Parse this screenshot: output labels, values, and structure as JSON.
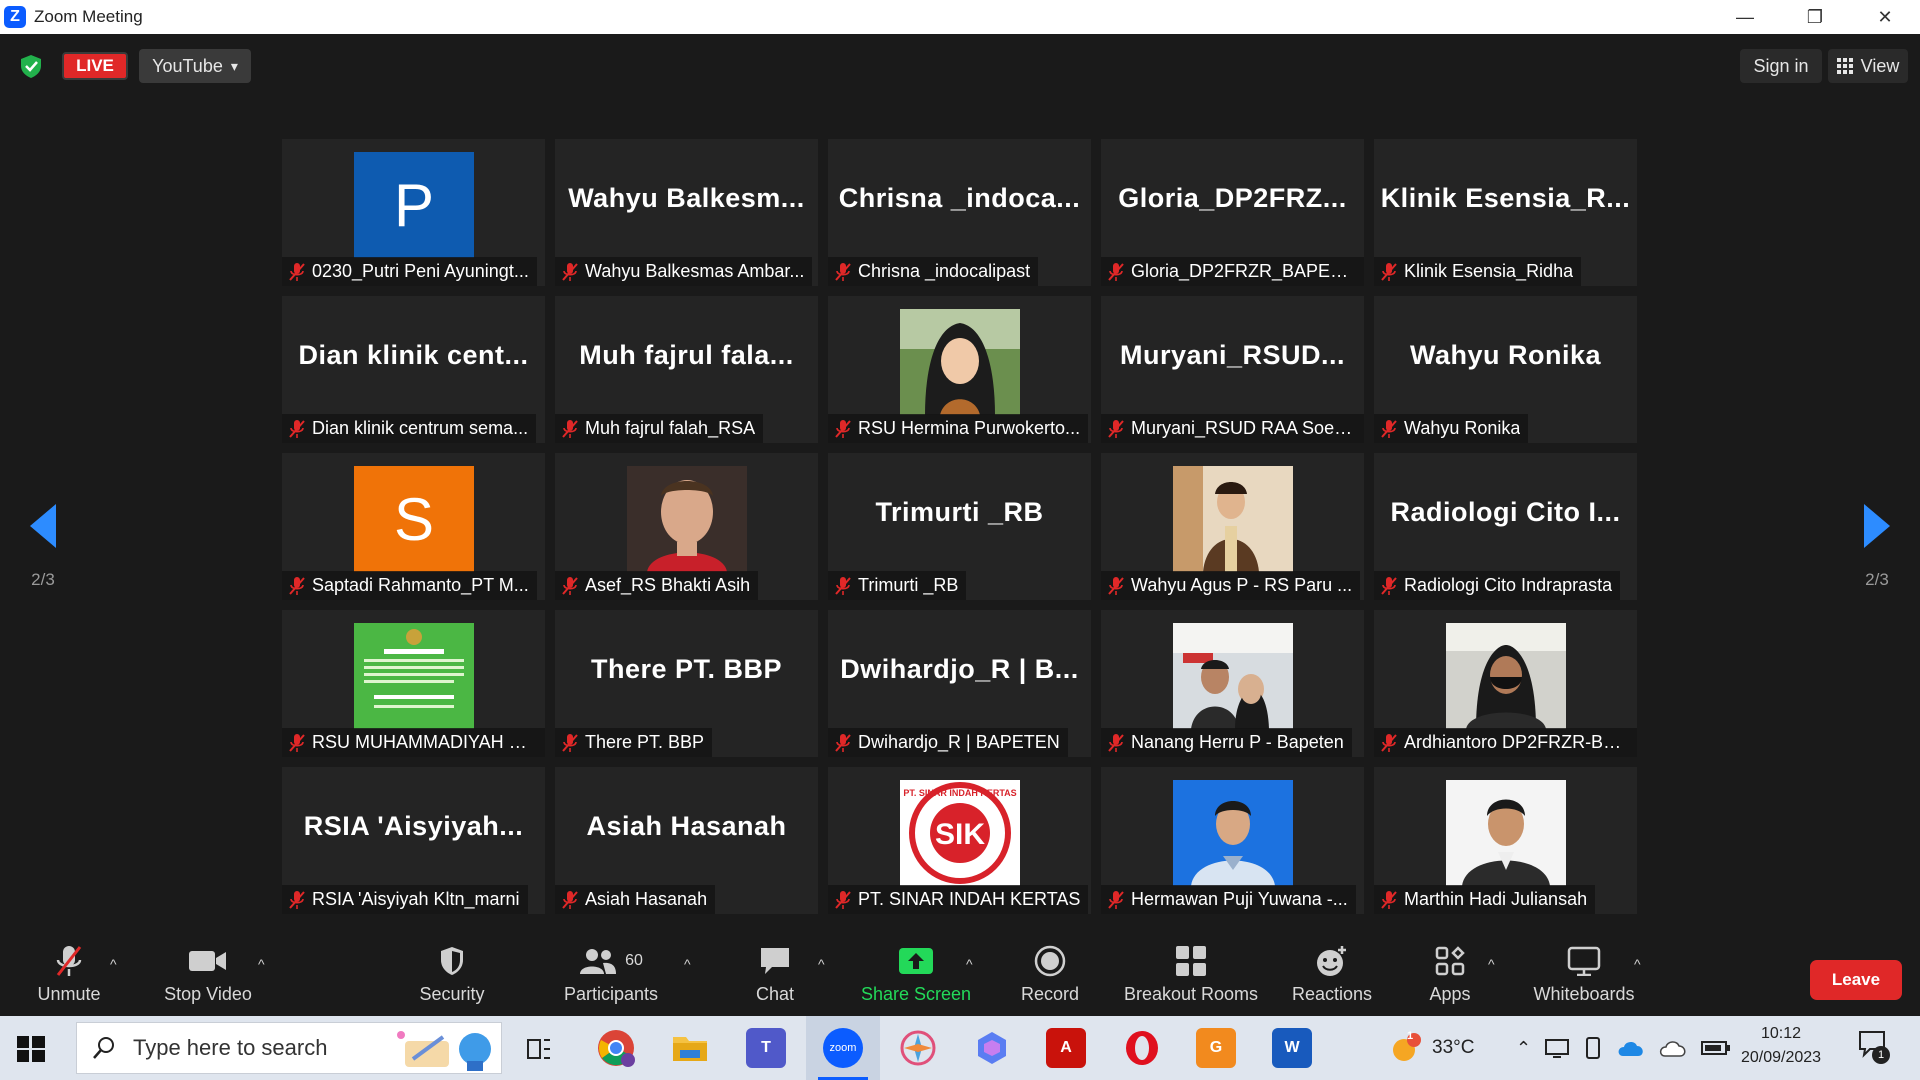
{
  "window": {
    "title": "Zoom Meeting",
    "app_letter": "Z",
    "minimize": "—",
    "restore": "❐",
    "close": "✕"
  },
  "topbar": {
    "live_label": "LIVE",
    "stream_label": "YouTube",
    "stream_caret": "▾",
    "signin_label": "Sign in",
    "view_label": "View"
  },
  "pager": {
    "left_page": "2/3",
    "right_page": "2/3"
  },
  "tiles": [
    {
      "big": "",
      "label": "0230_Putri Peni Ayuningt...",
      "avatar": {
        "letter": "P",
        "color": "#0e5bb0"
      }
    },
    {
      "big": "Wahyu  Balkesm...",
      "label": "Wahyu Balkesmas Ambar..."
    },
    {
      "big": "Chrisna  _indoca...",
      "label": "Chrisna _indocalipast"
    },
    {
      "big": "Gloria_DP2FRZ...",
      "label": "Gloria_DP2FRZR_BAPETEN"
    },
    {
      "big": "Klinik  Esensia_R...",
      "label": "Klinik Esensia_Ridha"
    },
    {
      "big": "Dian  klinik  cent...",
      "label": "Dian klinik centrum sema..."
    },
    {
      "big": "Muh  fajrul  fala...",
      "label": "Muh fajrul falah_RSA"
    },
    {
      "big": "",
      "label": "RSU Hermina Purwokerto...",
      "photo": "hijab"
    },
    {
      "big": "Muryani_RSUD...",
      "label": "Muryani_RSUD RAA Soew..."
    },
    {
      "big": "Wahyu  Ronika",
      "label": "Wahyu Ronika"
    },
    {
      "big": "",
      "label": "Saptadi Rahmanto_PT M...",
      "avatar": {
        "letter": "S",
        "color": "#f07308"
      }
    },
    {
      "big": "",
      "label": "Asef_RS Bhakti Asih",
      "photo": "athlete"
    },
    {
      "big": "Trimurti  _RB",
      "label": "Trimurti _RB"
    },
    {
      "big": "",
      "label": "Wahyu Agus P - RS Paru ...",
      "photo": "person"
    },
    {
      "big": "Radiologi  Cito  I...",
      "label": "Radiologi Cito Indraprasta"
    },
    {
      "big": "",
      "label": "RSU MUHAMMADIYAH SI...",
      "photo": "poster"
    },
    {
      "big": "There  PT.  BBP",
      "label": "There PT. BBP"
    },
    {
      "big": "Dwihardjo_R  |  B...",
      "label": "Dwihardjo_R | BAPETEN"
    },
    {
      "big": "",
      "label": "Nanang Herru P - Bapeten",
      "photo": "couple"
    },
    {
      "big": "",
      "label": "Ardhiantoro DP2FRZR-BA...",
      "photo": "masked"
    },
    {
      "big": "RSIA  'Aisyiyah...",
      "label": "RSIA 'Aisyiyah Kltn_marni"
    },
    {
      "big": "Asiah  Hasanah",
      "label": "Asiah Hasanah"
    },
    {
      "big": "",
      "label": "PT. SINAR INDAH KERTAS",
      "photo": "sik"
    },
    {
      "big": "",
      "label": "Hermawan Puji Yuwana -...",
      "photo": "blueportrait"
    },
    {
      "big": "",
      "label": "Marthin Hadi Juliansah",
      "photo": "whiteportrait"
    }
  ],
  "sik_logo": {
    "letters": "SIK",
    "ring_text": "PT. SINAR INDAH KERTAS"
  },
  "toolbar": {
    "unmute": "Unmute",
    "stop_video": "Stop Video",
    "security": "Security",
    "participants": "Participants",
    "participants_count": "60",
    "chat": "Chat",
    "share_screen": "Share Screen",
    "record": "Record",
    "breakout": "Breakout Rooms",
    "reactions": "Reactions",
    "apps": "Apps",
    "whiteboards": "Whiteboards",
    "leave": "Leave",
    "caret": "^"
  },
  "colors": {
    "accent": "#2d8cff",
    "live": "#e02828",
    "share": "#23d959",
    "leave": "#e02828"
  },
  "taskbar": {
    "search_placeholder": "Type here to search",
    "zoom_label": "zoom",
    "weather_temp": "33°C",
    "weather_badge": "1",
    "time": "10:12",
    "date": "20/09/2023",
    "notification_count": "1"
  }
}
